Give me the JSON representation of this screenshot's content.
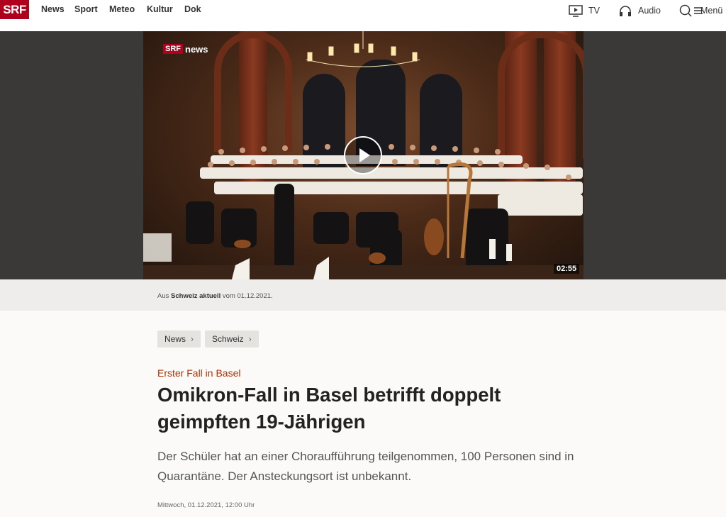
{
  "brand": {
    "logo_text": "SRF",
    "brand_color": "#af001e"
  },
  "nav": {
    "items": [
      {
        "label": "News"
      },
      {
        "label": "Sport"
      },
      {
        "label": "Meteo"
      },
      {
        "label": "Kultur"
      },
      {
        "label": "Dok"
      }
    ],
    "right": {
      "tv_label": "TV",
      "tv_icon": "tv-play-icon",
      "audio_label": "Audio",
      "audio_icon": "headphones-icon",
      "menu_label": "Menü",
      "menu_icon": "search-menu-icon"
    }
  },
  "video": {
    "overlay_logo": "SRF",
    "overlay_logo_suffix": "news",
    "duration": "02:55",
    "play_icon": "play-icon"
  },
  "caption": {
    "prefix": "Aus",
    "show": "Schweiz aktuell",
    "suffix": "vom 01.12.2021."
  },
  "breadcrumbs": [
    {
      "label": "News",
      "chevron": "›"
    },
    {
      "label": "Schweiz",
      "chevron": "›"
    }
  ],
  "article": {
    "kicker": "Erster Fall in Basel",
    "title": "Omikron-Fall in Basel betrifft doppelt geimpften 19-Jährigen",
    "lead": "Der Schüler hat an einer Choraufführung teilgenommen, 100 Personen sind in Quarantäne. Der Ansteckungsort ist unbekannt.",
    "date": "Mittwoch, 01.12.2021, 12:00 Uhr"
  },
  "colors": {
    "accent": "#af3300",
    "chip_bg": "#e5e3e0",
    "video_band": "#3a3937"
  }
}
